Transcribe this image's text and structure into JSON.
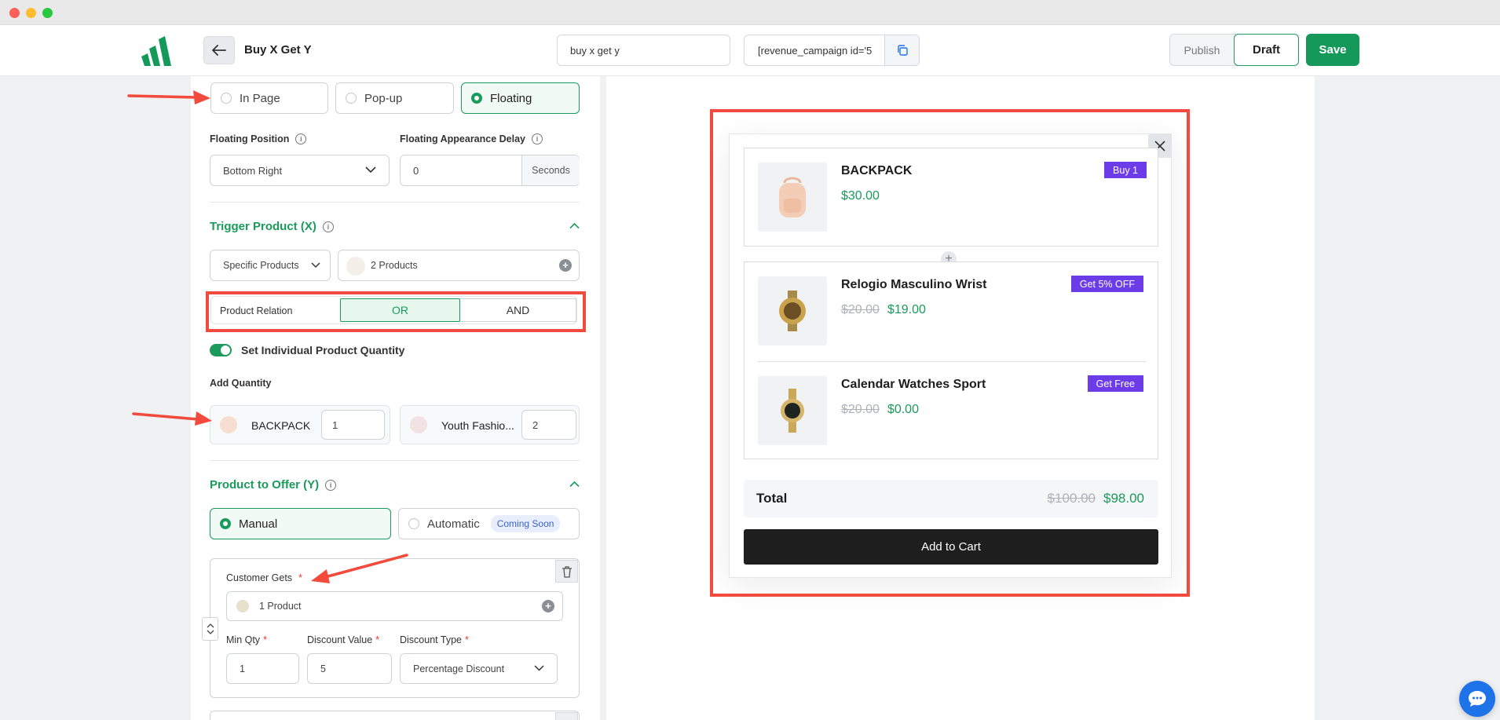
{
  "header": {
    "campaign_title": "Buy X Get Y",
    "name_value": "buy x get y",
    "shortcode": "[revenue_campaign id='5",
    "publish_label": "Publish",
    "draft_label": "Draft",
    "save_label": "Save"
  },
  "display": {
    "options": [
      "In Page",
      "Pop-up",
      "Floating"
    ],
    "selected": "Floating"
  },
  "floating": {
    "position_label": "Floating Position",
    "position_value": "Bottom Right",
    "delay_label": "Floating Appearance Delay",
    "delay_value": "0",
    "delay_unit": "Seconds"
  },
  "trigger": {
    "title": "Trigger Product (X)",
    "type_value": "Specific Products",
    "products_value": "2 Products",
    "relation_label": "Product Relation",
    "relation_or": "OR",
    "relation_and": "AND",
    "relation_selected": "OR",
    "toggle_label": "Set Individual Product Quantity",
    "toggle_on": true,
    "add_qty_label": "Add Quantity",
    "quantities": [
      {
        "name": "BACKPACK",
        "qty": "1"
      },
      {
        "name": "Youth Fashio...",
        "qty": "2"
      }
    ]
  },
  "offer": {
    "title": "Product to Offer (Y)",
    "manual_label": "Manual",
    "automatic_label": "Automatic",
    "coming_soon": "Coming Soon",
    "customer_gets_label": "Customer Gets",
    "customer_gets_value": "1 Product",
    "min_qty_label": "Min Qty",
    "min_qty_value": "1",
    "discount_value_label": "Discount Value",
    "discount_value": "5",
    "discount_type_label": "Discount Type",
    "discount_type_value": "Percentage Discount",
    "required_mark": "*"
  },
  "preview": {
    "products": [
      {
        "name": "BACKPACK",
        "price": "$30.00",
        "old_price": "",
        "badge": "Buy 1"
      },
      {
        "name": "Relogio Masculino Wrist",
        "price": "$19.00",
        "old_price": "$20.00",
        "badge": "Get 5% OFF"
      },
      {
        "name": "Calendar Watches Sport",
        "price": "$0.00",
        "old_price": "$20.00",
        "badge": "Get Free"
      }
    ],
    "total_label": "Total",
    "total_old": "$100.00",
    "total_new": "$98.00",
    "cart_label": "Add to Cart",
    "connector_symbol": "+"
  },
  "colors": {
    "brand_green": "#14995b",
    "badge_purple": "#6b3ce8",
    "annotation_red": "#f24a3d"
  }
}
